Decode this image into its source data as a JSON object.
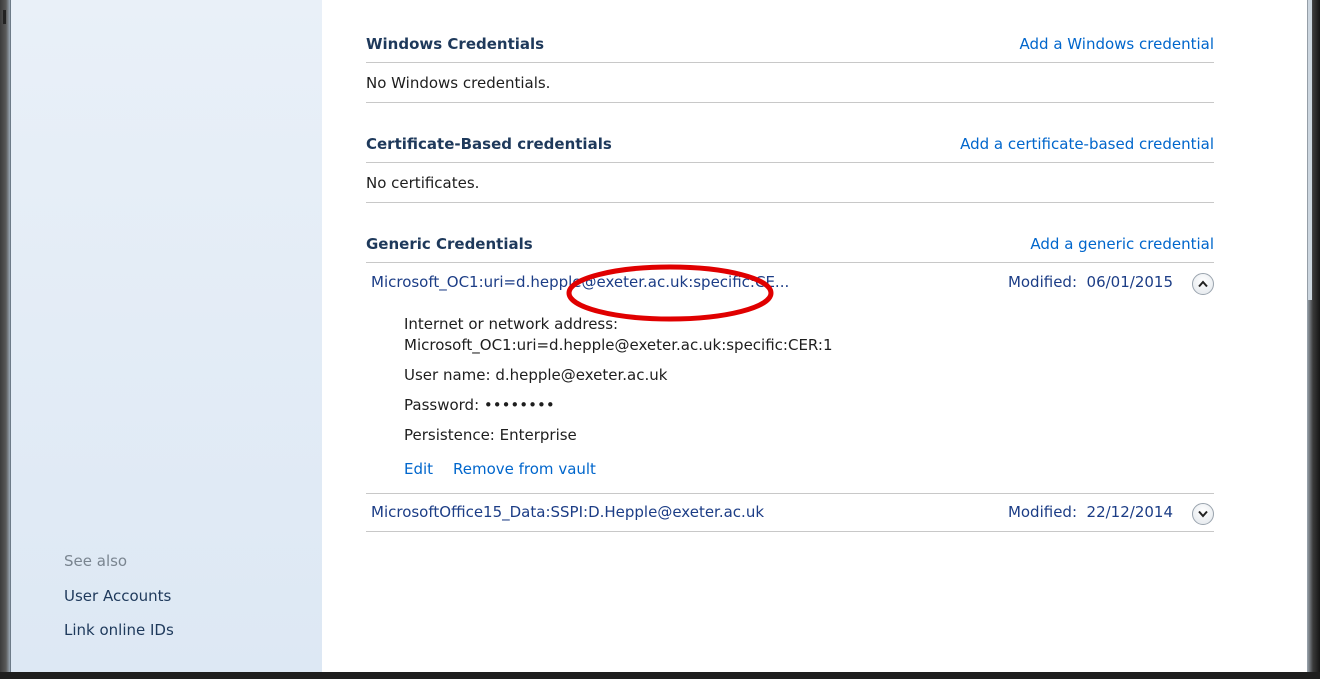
{
  "sidebar": {
    "see_also": "See also",
    "links": [
      "User Accounts",
      "Link online IDs"
    ]
  },
  "sections": {
    "windows": {
      "title": "Windows Credentials",
      "action": "Add a Windows credential",
      "empty": "No Windows credentials."
    },
    "certificate": {
      "title": "Certificate-Based credentials",
      "action": "Add a certificate-based credential",
      "empty": "No certificates."
    },
    "generic": {
      "title": "Generic Credentials",
      "action": "Add a generic credential",
      "items": [
        {
          "name": "Microsoft_OC1:uri=d.hepple@exeter.ac.uk:specific:CE...",
          "modified": "Modified:  06/01/2015",
          "expanded": true,
          "details": {
            "address_label": "Internet or network address:",
            "address_value": "Microsoft_OC1:uri=d.hepple@exeter.ac.uk:specific:CER:1",
            "username": "User name:  d.hepple@exeter.ac.uk",
            "password": "Password:  ••••••••",
            "persistence": "Persistence:  Enterprise",
            "edit": "Edit",
            "remove": "Remove from vault"
          }
        },
        {
          "name": "MicrosoftOffice15_Data:SSPI:D.Hepple@exeter.ac.uk",
          "modified": "Modified:  22/12/2014",
          "expanded": false
        }
      ]
    }
  },
  "icons": {
    "collapse": "chevron-up-icon",
    "expand": "chevron-down-icon"
  },
  "colors": {
    "link": "#0066cc",
    "heading": "#1e395b",
    "sidebar_bg": "#e3ecf6",
    "annotation": "#e00000"
  }
}
